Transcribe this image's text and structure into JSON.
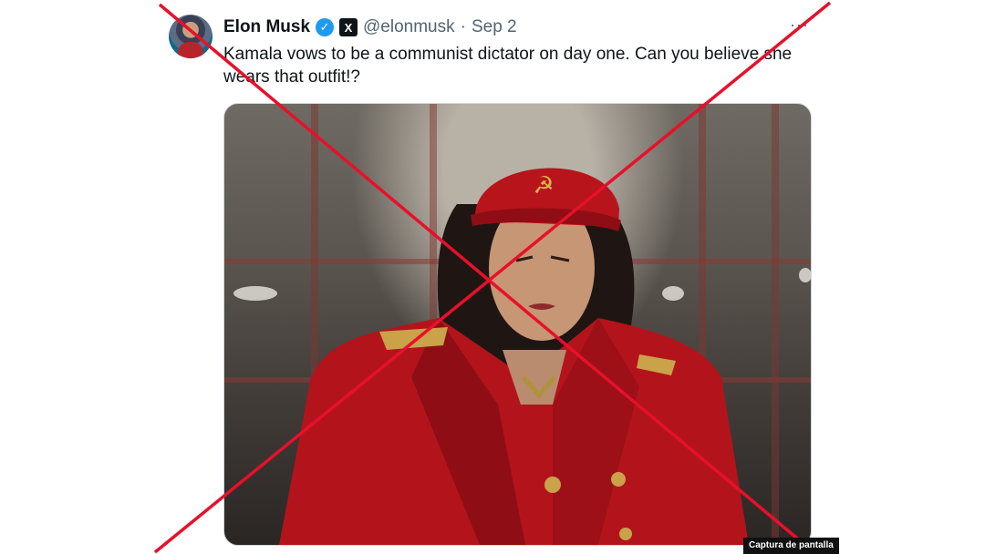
{
  "tweet": {
    "author_name": "Elon Musk",
    "handle": "@elonmusk",
    "separator": "·",
    "date": "Sep 2",
    "text": "Kamala vows to be a communist dictator on day one. Can you believe she wears that outfit!?",
    "verified_icon": "verified-badge-icon",
    "affiliate_icon": "x-logo-icon",
    "more_icon": "more-options-icon"
  },
  "overlay": {
    "caption_tag": "Captura de pantalla",
    "cross_color": "#e8102a"
  },
  "colors": {
    "verified": "#1d9bf0",
    "text": "#0f1419",
    "muted": "#536471"
  }
}
